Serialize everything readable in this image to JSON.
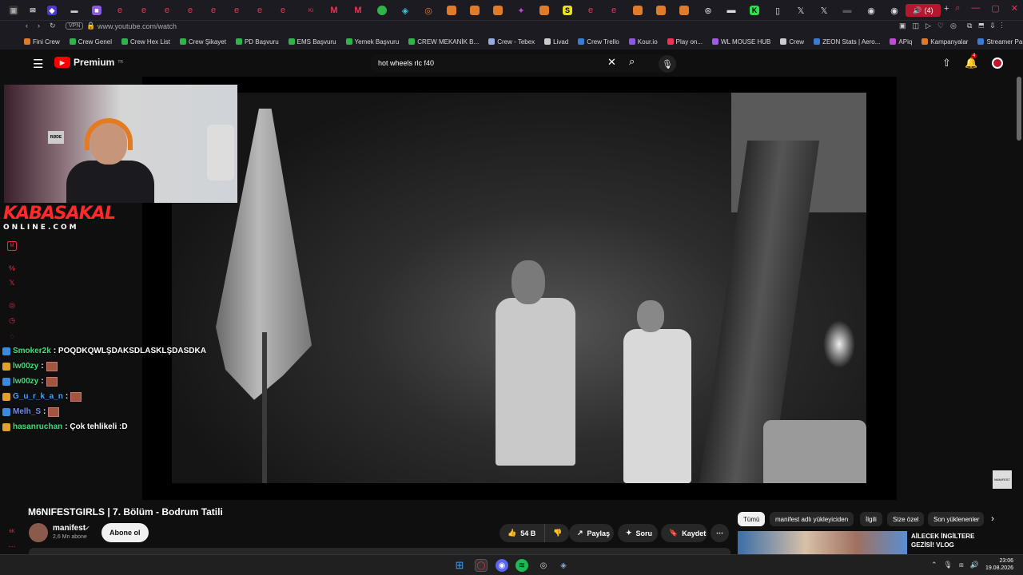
{
  "browser": {
    "url": "www.youtube.com/watch",
    "vpn_label": "VPN",
    "audio_tab_count": "(4)",
    "bookmarks": [
      {
        "label": "Fini Crew",
        "color": "#e07b2a"
      },
      {
        "label": "Crew Genel",
        "color": "#2fb34a"
      },
      {
        "label": "Crew Hex List",
        "color": "#2fb34a"
      },
      {
        "label": "Crew Şikayet",
        "color": "#2fb34a"
      },
      {
        "label": "PD Başvuru",
        "color": "#2fb34a"
      },
      {
        "label": "EMS Başvuru",
        "color": "#2fb34a"
      },
      {
        "label": "Yemek Başvuru",
        "color": "#2fb34a"
      },
      {
        "label": "CREW MEKANİK B...",
        "color": "#2fb34a"
      },
      {
        "label": "Crew - Tebex",
        "color": "#9ad"
      },
      {
        "label": "Livad",
        "color": "#ccc"
      },
      {
        "label": "Crew Trello",
        "color": "#3a7bd5"
      },
      {
        "label": "Kour.io",
        "color": "#8a5be0"
      },
      {
        "label": "Play on...",
        "color": "#e35"
      },
      {
        "label": "WL MOUSE HUB",
        "color": "#a05be0"
      },
      {
        "label": "Crew",
        "color": "#ccc"
      },
      {
        "label": "ZEON Stats | Aero...",
        "color": "#3a7bd5"
      },
      {
        "label": "APiq",
        "color": "#c34ad5"
      },
      {
        "label": "Kampanyalar",
        "color": "#e07b2a"
      },
      {
        "label": "Streamer Panel",
        "color": "#3a7bd5"
      }
    ]
  },
  "youtube": {
    "logo_text": "Premium",
    "logo_sup": "TR",
    "search_value": "hot wheels rlc f40",
    "notification_count": "4"
  },
  "overlay": {
    "brand_line1": "KABASAKAL",
    "brand_line2": "ONLINE.COM",
    "cam_mic_label": "RØDE",
    "chat": [
      {
        "user": "Smoker2k",
        "user_color": "#3ee07a",
        "message": ": POQDKQWLŞDAKSDLASKLŞDASDKA",
        "emote": false
      },
      {
        "user": "lw00zy",
        "user_color": "#3ee07a",
        "message": ":",
        "emote": true
      },
      {
        "user": "lw00zy",
        "user_color": "#3ee07a",
        "message": ":",
        "emote": true
      },
      {
        "user": "G_u_r_k_a_n",
        "user_color": "#4aa3ff",
        "message": ":",
        "emote": true
      },
      {
        "user": "Melh_S",
        "user_color": "#6a8cff",
        "message": ":",
        "emote": true
      },
      {
        "user": "hasanruchan",
        "user_color": "#3ee07a",
        "message": ": Çok tehlikeli :D",
        "emote": false
      }
    ]
  },
  "video": {
    "title": "M6NIFESTGIRLS | 7. Bölüm - Bodrum Tatili",
    "watermark": "M6NIFEST",
    "channel_name": "manifest",
    "channel_subs": "2,6 Mn abone",
    "subscribe_label": "Abone ol",
    "like_count": "54 B",
    "share_label": "Paylaş",
    "ask_label": "Soru",
    "save_label": "Kaydet"
  },
  "recommendations": {
    "chips": [
      "Tümü",
      "manifest adlı yükleyiciden",
      "İlgili",
      "Size özel",
      "Son yüklenenler"
    ],
    "first_title": "AİLECEK İNGİLTERE GEZİSİ! VLOG"
  },
  "taskbar": {
    "time": "23:06",
    "date": "19.08.2026"
  }
}
